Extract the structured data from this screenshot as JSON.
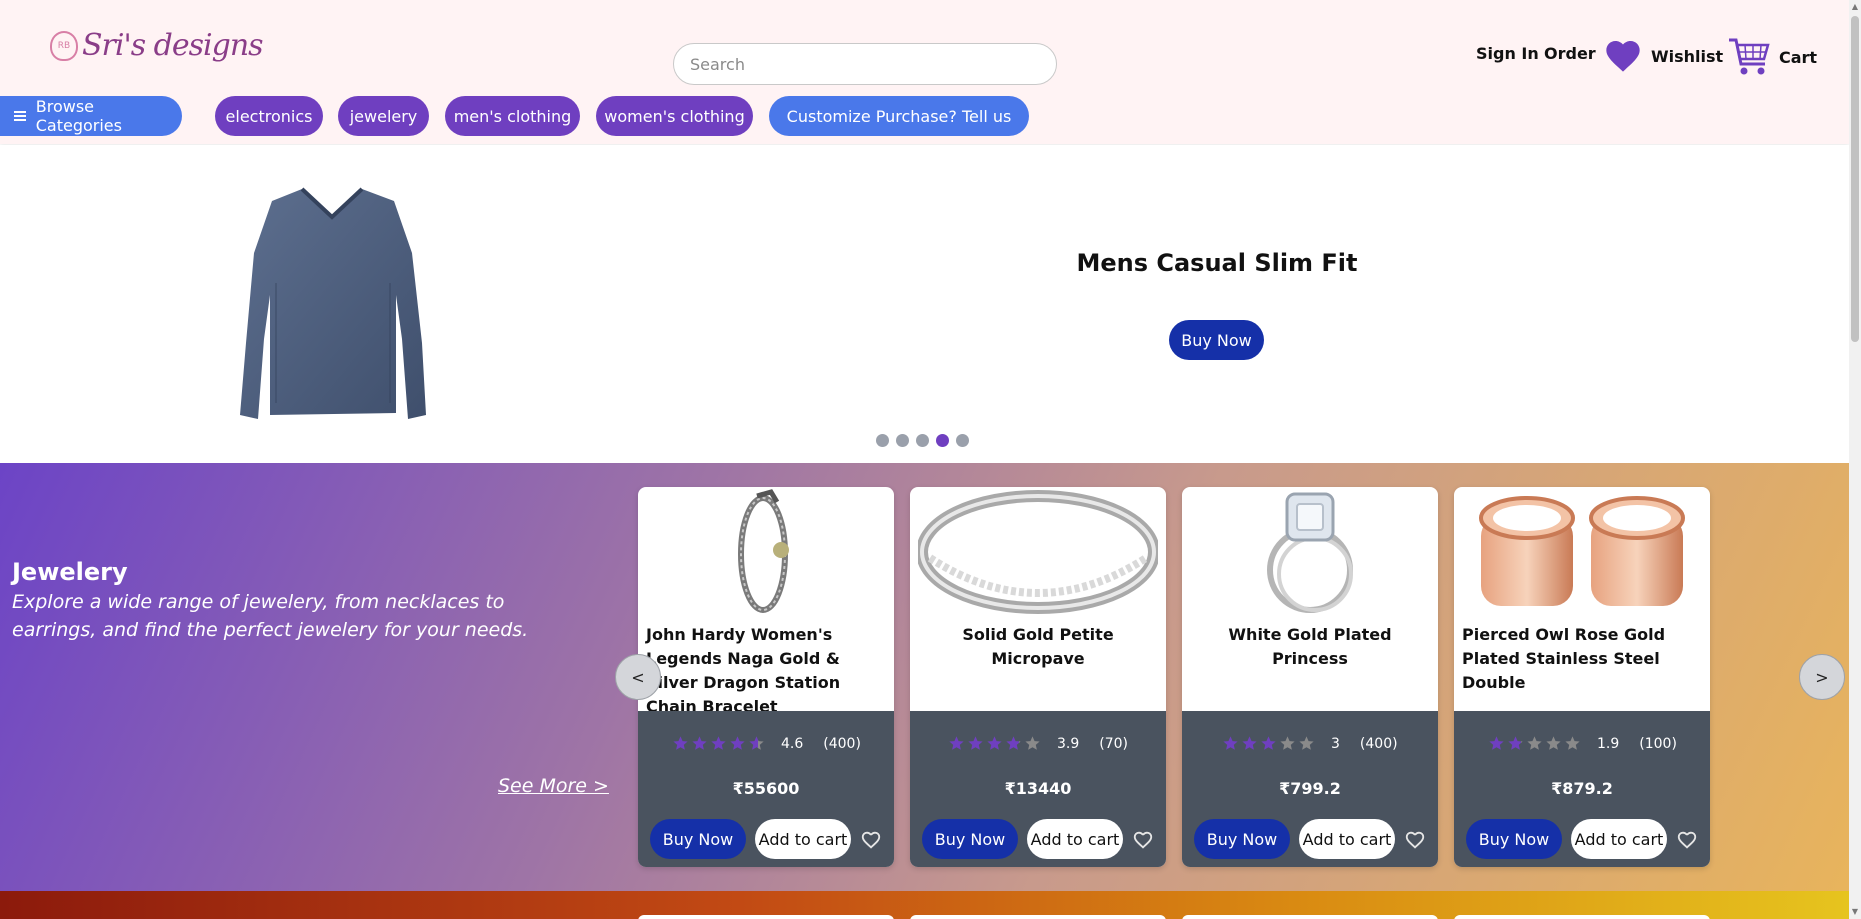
{
  "header": {
    "logo_text": "Sri's designs",
    "logo_mark": "RB",
    "search_placeholder": "Search",
    "sign_in": "Sign In",
    "order": "Order",
    "wishlist": "Wishlist",
    "cart": "Cart"
  },
  "categories": {
    "browse_label": "Browse Categories",
    "items": [
      "electronics",
      "jewelery",
      "men's clothing",
      "women's clothing"
    ],
    "customize_label": "Customize Purchase? Tell us"
  },
  "hero": {
    "title": "Mens Casual Slim Fit",
    "buy_label": "Buy Now",
    "slide_count": 5,
    "active_slide": 4
  },
  "section": {
    "title": "Jewelery",
    "description": "Explore a wide range of jewelery, from necklaces to earrings, and find the perfect jewelery for your needs.",
    "see_more": "See More >",
    "prev_label": "<",
    "next_label": ">",
    "products": [
      {
        "title": "John Hardy Women's Legends Naga Gold & Silver Dragon Station Chain Bracelet",
        "rating": 4.6,
        "rating_text": "4.6",
        "count": "(400)",
        "price": "₹55600",
        "buy": "Buy Now",
        "add": "Add to cart",
        "image": "chain-bracelet"
      },
      {
        "title": "Solid Gold Petite Micropave",
        "rating": 3.9,
        "rating_text": "3.9",
        "count": "(70)",
        "price": "₹13440",
        "buy": "Buy Now",
        "add": "Add to cart",
        "image": "micropave-ring"
      },
      {
        "title": "White Gold Plated Princess",
        "rating": 3,
        "rating_text": "3",
        "count": "(400)",
        "price": "₹799.2",
        "buy": "Buy Now",
        "add": "Add to cart",
        "image": "princess-ring"
      },
      {
        "title": "Pierced Owl Rose Gold Plated Stainless Steel Double",
        "rating": 1.9,
        "rating_text": "1.9",
        "count": "(100)",
        "price": "₹879.2",
        "buy": "Buy Now",
        "add": "Add to cart",
        "image": "rose-gold-tunnels"
      }
    ]
  },
  "colors": {
    "accent_purple": "#6f3fc0",
    "accent_blue": "#4a78ea",
    "buy_blue": "#1530a8",
    "card_bottom": "#4a535f"
  },
  "icons": [
    "menu-icon",
    "heart-icon",
    "cart-icon",
    "star-icon",
    "heart-outline-icon"
  ]
}
